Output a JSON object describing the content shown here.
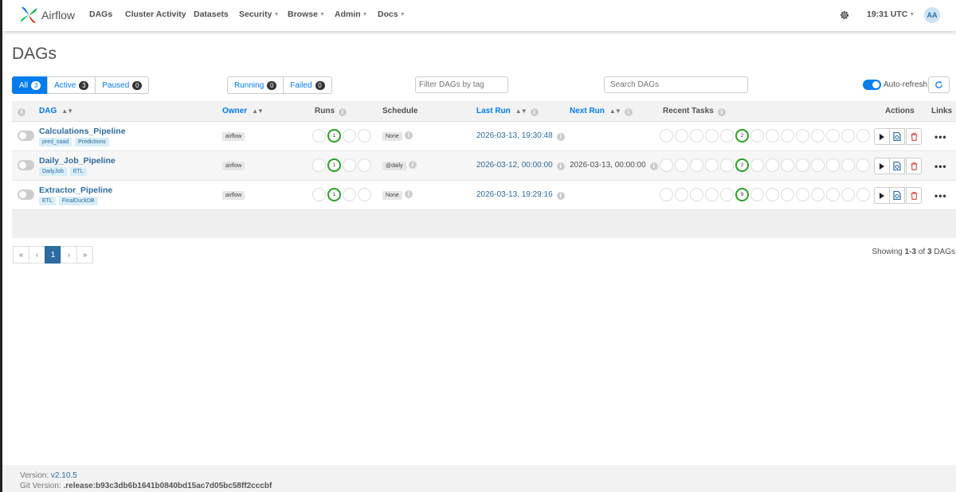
{
  "navbar": {
    "brand": "Airflow",
    "items": [
      {
        "label": "DAGs",
        "dropdown": false
      },
      {
        "label": "Cluster Activity",
        "dropdown": false
      },
      {
        "label": "Datasets",
        "dropdown": false
      },
      {
        "label": "Security",
        "dropdown": true
      },
      {
        "label": "Browse",
        "dropdown": true
      },
      {
        "label": "Admin",
        "dropdown": true
      },
      {
        "label": "Docs",
        "dropdown": true
      }
    ],
    "time": "19:31 UTC",
    "avatar": "AA"
  },
  "page_title": "DAGs",
  "status_filters": [
    {
      "label": "All",
      "count": "3"
    },
    {
      "label": "Active",
      "count": "3"
    },
    {
      "label": "Paused",
      "count": "0"
    }
  ],
  "run_filters": [
    {
      "label": "Running",
      "count": "0"
    },
    {
      "label": "Failed",
      "count": "0"
    }
  ],
  "tag_filter_placeholder": "Filter DAGs by tag",
  "search_placeholder": "Search DAGs",
  "auto_refresh_label": "Auto-refresh",
  "table": {
    "headers": {
      "dag": "DAG",
      "owner": "Owner",
      "runs": "Runs",
      "schedule": "Schedule",
      "last_run": "Last Run",
      "next_run": "Next Run",
      "recent_tasks": "Recent Tasks",
      "actions": "Actions",
      "links": "Links"
    },
    "rows": [
      {
        "name": "Calculations_Pipeline",
        "tags": [
          "pred_saad",
          "Predictions"
        ],
        "owner": "airflow",
        "runs_success": "1",
        "schedule": "None",
        "last_run": "2026-03-13, 19:30:48",
        "next_run": "",
        "tasks_success": "2"
      },
      {
        "name": "Daily_Job_Pipeline",
        "tags": [
          "DailyJob",
          "ETL"
        ],
        "owner": "airflow",
        "runs_success": "1",
        "schedule": "@daily",
        "last_run": "2026-03-12, 00:00:00",
        "next_run": "2026-03-13, 00:00:00",
        "tasks_success": "2"
      },
      {
        "name": "Extractor_Pipeline",
        "tags": [
          "ETL",
          "FinalDuckDB"
        ],
        "owner": "airflow",
        "runs_success": "1",
        "schedule": "None",
        "last_run": "2026-03-13, 19:29:16",
        "next_run": "",
        "tasks_success": "9"
      }
    ]
  },
  "pagination": {
    "first": "«",
    "prev": "‹",
    "current": "1",
    "next": "›",
    "last": "»"
  },
  "showing": {
    "prefix": "Showing ",
    "range": "1-3",
    "middle": " of ",
    "total": "3",
    "suffix": " DAGs"
  },
  "footer": {
    "version_label": "Version: ",
    "version": "v2.10.5",
    "git_label": "Git Version: ",
    "git_version": ".release:b93c3db6b1641b0840bd15ac7d05bc58ff2cccbf"
  },
  "colors": {
    "accent": "#017cee",
    "link": "#2c6ba0",
    "success": "#2aa02a"
  }
}
